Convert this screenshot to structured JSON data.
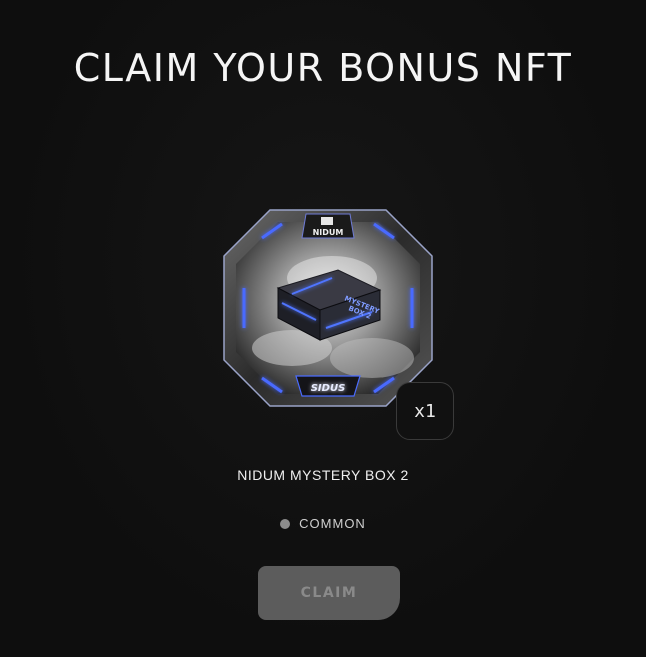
{
  "header": {
    "title": "CLAIM YOUR BONUS NFT"
  },
  "reward": {
    "name": "NIDUM MYSTERY BOX 2",
    "quantity": "x1",
    "rarity": "COMMON",
    "rarity_color": "#8c8c8c",
    "art": {
      "top_logo": "NIDUM",
      "box_text_line1": "MYSTERY",
      "box_text_line2": "BOX 2",
      "bottom_logo": "SIDUS",
      "glow_color": "#3d5cff"
    }
  },
  "actions": {
    "claim_label": "CLAIM",
    "claim_enabled": false
  }
}
